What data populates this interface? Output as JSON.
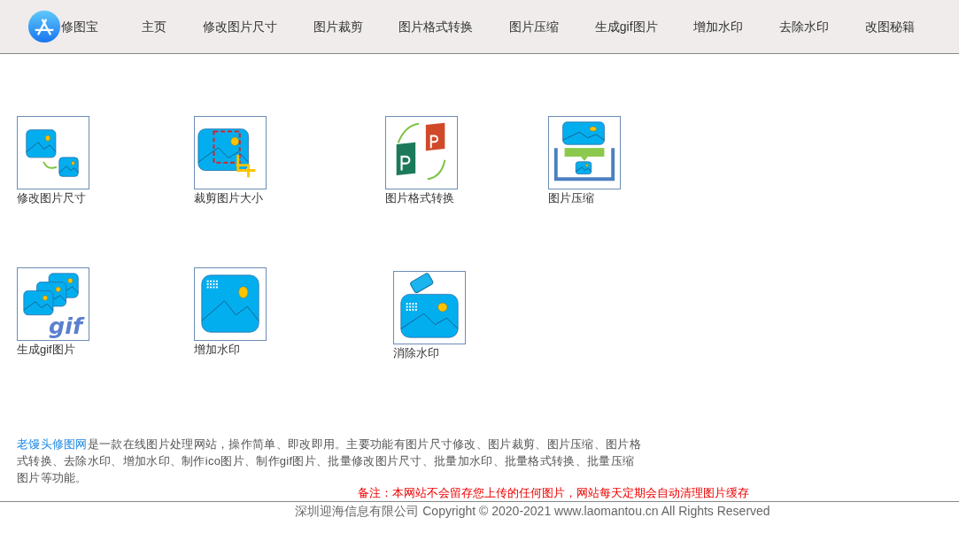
{
  "brand": {
    "name": "修图宝"
  },
  "nav": [
    {
      "label": "主页"
    },
    {
      "label": "修改图片尺寸"
    },
    {
      "label": "图片裁剪"
    },
    {
      "label": "图片格式转换"
    },
    {
      "label": "图片压缩"
    },
    {
      "label": "生成gif图片"
    },
    {
      "label": "增加水印"
    },
    {
      "label": "去除水印"
    },
    {
      "label": "改图秘籍"
    }
  ],
  "tools": [
    {
      "label": "修改图片尺寸",
      "kind": "resize"
    },
    {
      "label": "裁剪图片大小",
      "kind": "crop"
    },
    {
      "label": "图片格式转换",
      "kind": "convert"
    },
    {
      "label": "图片压缩",
      "kind": "compress"
    },
    {
      "label": "生成gif图片",
      "kind": "gif"
    },
    {
      "label": "增加水印",
      "kind": "watermark"
    },
    {
      "label": "消除水印",
      "kind": "eraser"
    }
  ],
  "description": {
    "link": "老馒头修图网",
    "text": "是一款在线图片处理网站，操作简单、即改即用。主要功能有图片尺寸修改、图片裁剪、图片压缩、图片格式转换、去除水印、增加水印、制作ico图片、制作gif图片、批量修改图片尺寸、批量加水印、批量格式转换、批量压缩图片等功能。"
  },
  "notice": "备注：本网站不会留存您上传的任何图片，网站每天定期会自动清理图片缓存",
  "footer": "深圳迎海信息有限公司 Copyright © 2020-2021 www.laomantou.cn All Rights Reserved"
}
